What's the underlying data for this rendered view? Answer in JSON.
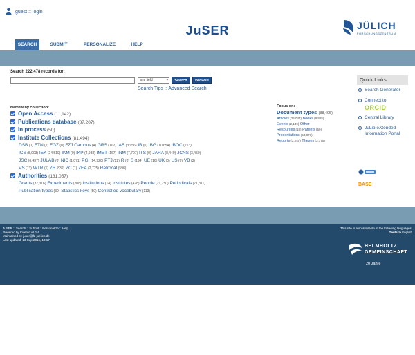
{
  "user": {
    "label": "guest :: login"
  },
  "site": {
    "title": "JuSER"
  },
  "logo": {
    "text": "JÜLICH",
    "sub": "FORSCHUNGSZENTRUM"
  },
  "tabs": [
    {
      "label": "SEARCH",
      "active": true
    },
    {
      "label": "SUBMIT",
      "active": false
    },
    {
      "label": "PERSONALIZE",
      "active": false
    },
    {
      "label": "HELP",
      "active": false
    }
  ],
  "search": {
    "records_label": "Search 222,478 records for:",
    "input_value": "",
    "field_select": "any field",
    "search_button": "Search",
    "browse_button": "Browse",
    "tips": "Search Tips",
    "advanced": "Advanced Search"
  },
  "narrow": {
    "label": "Narrow by collection:",
    "collections": [
      {
        "name": "Open Access",
        "count": "(11,142)"
      },
      {
        "name": "Publications database",
        "count": "(87,207)"
      },
      {
        "name": "In process",
        "count": "(50)"
      },
      {
        "name": "Institute Collections",
        "count": "(81,494)"
      },
      {
        "name": "Authorities",
        "count": "(131,057)"
      }
    ],
    "institute_lines": [
      [
        [
          "DSB",
          "(0)"
        ],
        [
          "ETN",
          "(2)"
        ],
        [
          "FGZ",
          "(0)"
        ],
        [
          "FZJ Campus",
          "(4)"
        ],
        [
          "GRS",
          "(102)"
        ],
        [
          "IAS",
          "(3,956)"
        ],
        [
          "IB",
          "(0)"
        ],
        [
          "IBG",
          "(10,654)"
        ],
        [
          "IBOC",
          "(213)"
        ]
      ],
      [
        [
          "ICS",
          "(8,903)"
        ],
        [
          "IEK",
          "(24,519)"
        ],
        [
          "IKM",
          "(0)"
        ],
        [
          "IKP",
          "(4,938)"
        ],
        [
          "IMET",
          "(167)"
        ],
        [
          "INM",
          "(7,707)"
        ],
        [
          "ITS",
          "(0)"
        ],
        [
          "JARA",
          "(8,440)"
        ],
        [
          "JCNS",
          "(3,459)"
        ]
      ],
      [
        [
          "JSC",
          "(6,437)"
        ],
        [
          "JULAB",
          "(0)"
        ],
        [
          "NIC",
          "(1,071)"
        ],
        [
          "PGI",
          "(14,920)"
        ],
        [
          "PTJ",
          "(22)"
        ],
        [
          "R",
          "(0)"
        ],
        [
          "S",
          "(194)"
        ],
        [
          "UE",
          "(16)"
        ],
        [
          "UK",
          "(0)"
        ],
        [
          "US",
          "(0)"
        ],
        [
          "VB",
          "(3)"
        ]
      ],
      [
        [
          "VS",
          "(13)"
        ],
        [
          "WTR",
          "(1)"
        ],
        [
          "ZB",
          "(832)"
        ],
        [
          "ZC",
          "(1)"
        ],
        [
          "ZEA",
          "(2,775)"
        ],
        [
          "Retrocat",
          "(598)"
        ]
      ]
    ],
    "authority_lines": [
      [
        [
          "Grants",
          "(37,316)"
        ],
        [
          "Experiments",
          "(208)"
        ],
        [
          "Institutions",
          "(14)"
        ],
        [
          "Institutes",
          "(478)"
        ],
        [
          "People",
          "(21,750)"
        ],
        [
          "Periodicals",
          "(71,311)"
        ]
      ],
      [
        [
          "Publication types",
          "(39)"
        ],
        [
          "Statistics keys",
          "(50)"
        ],
        [
          "Controlled vocabulary",
          "(113)"
        ]
      ]
    ]
  },
  "focus": {
    "label": "Focus on:",
    "head": "Document types",
    "head_count": "(88,495)",
    "lines": [
      [
        [
          "Articles",
          "(25,047)"
        ],
        [
          "Books",
          "(9,825)"
        ]
      ],
      [
        [
          "Events",
          "(2,149)"
        ],
        [
          "Other",
          ""
        ]
      ],
      [
        [
          "Resources",
          "(18)"
        ],
        [
          "Patents",
          "(50)"
        ]
      ],
      [
        [
          "Presentations",
          "(53,873)"
        ]
      ],
      [
        [
          "Reports",
          "(2,240)"
        ],
        [
          "Theses",
          "(3,170)"
        ]
      ]
    ]
  },
  "quick_links": {
    "title": "Quick Links",
    "items": [
      "Search Generator",
      "Connect to",
      "Central Library",
      "JuLib eXtended Information Portal"
    ],
    "orcid": "ORCID",
    "base": "BASE"
  },
  "footer": {
    "nav": "JuSER :: Search :: Submit :: Personalize :: Help",
    "powered": "Powered by Invenio v1.1.6",
    "maintained": "Maintained by juser@fz-juelich.de",
    "updated": "Last updated: 23 Sep 2016, 10:17",
    "lang_note": "This site is also available in the following languages:",
    "lang_de": "Deutsch",
    "lang_en": "English",
    "helmholtz_1": "HELMHOLTZ",
    "helmholtz_2": "GEMEINSCHAFT",
    "helmholtz_3": "20 Jahre"
  },
  "colors": {
    "accent": "#1f4e8c",
    "banner": "#7a9cb3",
    "footer": "#244a6b"
  }
}
